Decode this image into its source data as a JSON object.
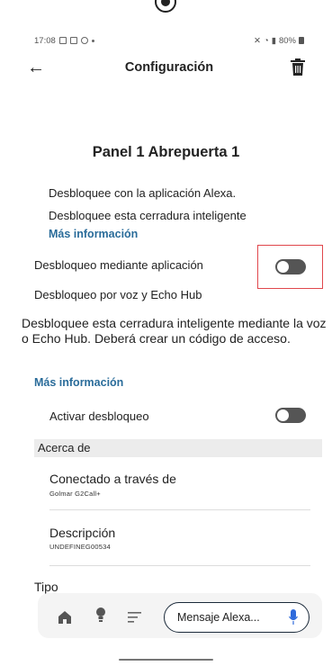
{
  "status_bar": {
    "time": "17:08",
    "battery": "80%"
  },
  "header": {
    "title": "Configuración"
  },
  "panel": {
    "title": "Panel 1 Abrepuerta 1"
  },
  "alexa": {
    "line1": "Desbloquee con la aplicación Alexa.",
    "line2": "Desbloquee esta cerradura inteligente",
    "more_info": "Más información"
  },
  "app_unlock": {
    "label": "Desbloqueo mediante aplicación",
    "enabled": false
  },
  "voice_unlock": {
    "label": "Desbloqueo por voz y Echo Hub",
    "description": "Desbloquee esta cerradura inteligente mediante la voz o Echo Hub. Deberá crear un código de acceso.",
    "more_info": "Más información",
    "activate_label": "Activar desbloqueo",
    "activate_enabled": false
  },
  "about": {
    "header": "Acerca de",
    "items": [
      {
        "title": "Conectado a través de",
        "value": "Golmar G2Call+"
      },
      {
        "title": "Descripción",
        "value": "UNDEFINEG00534"
      },
      {
        "title": "Tipo",
        "value": ""
      }
    ]
  },
  "bottom_nav": {
    "message_placeholder": "Mensaje Alexa..."
  },
  "colors": {
    "link": "#2a6c9a",
    "toggle_off": "#555555",
    "highlight": "#e0474c",
    "mic": "#2f6bdc"
  }
}
